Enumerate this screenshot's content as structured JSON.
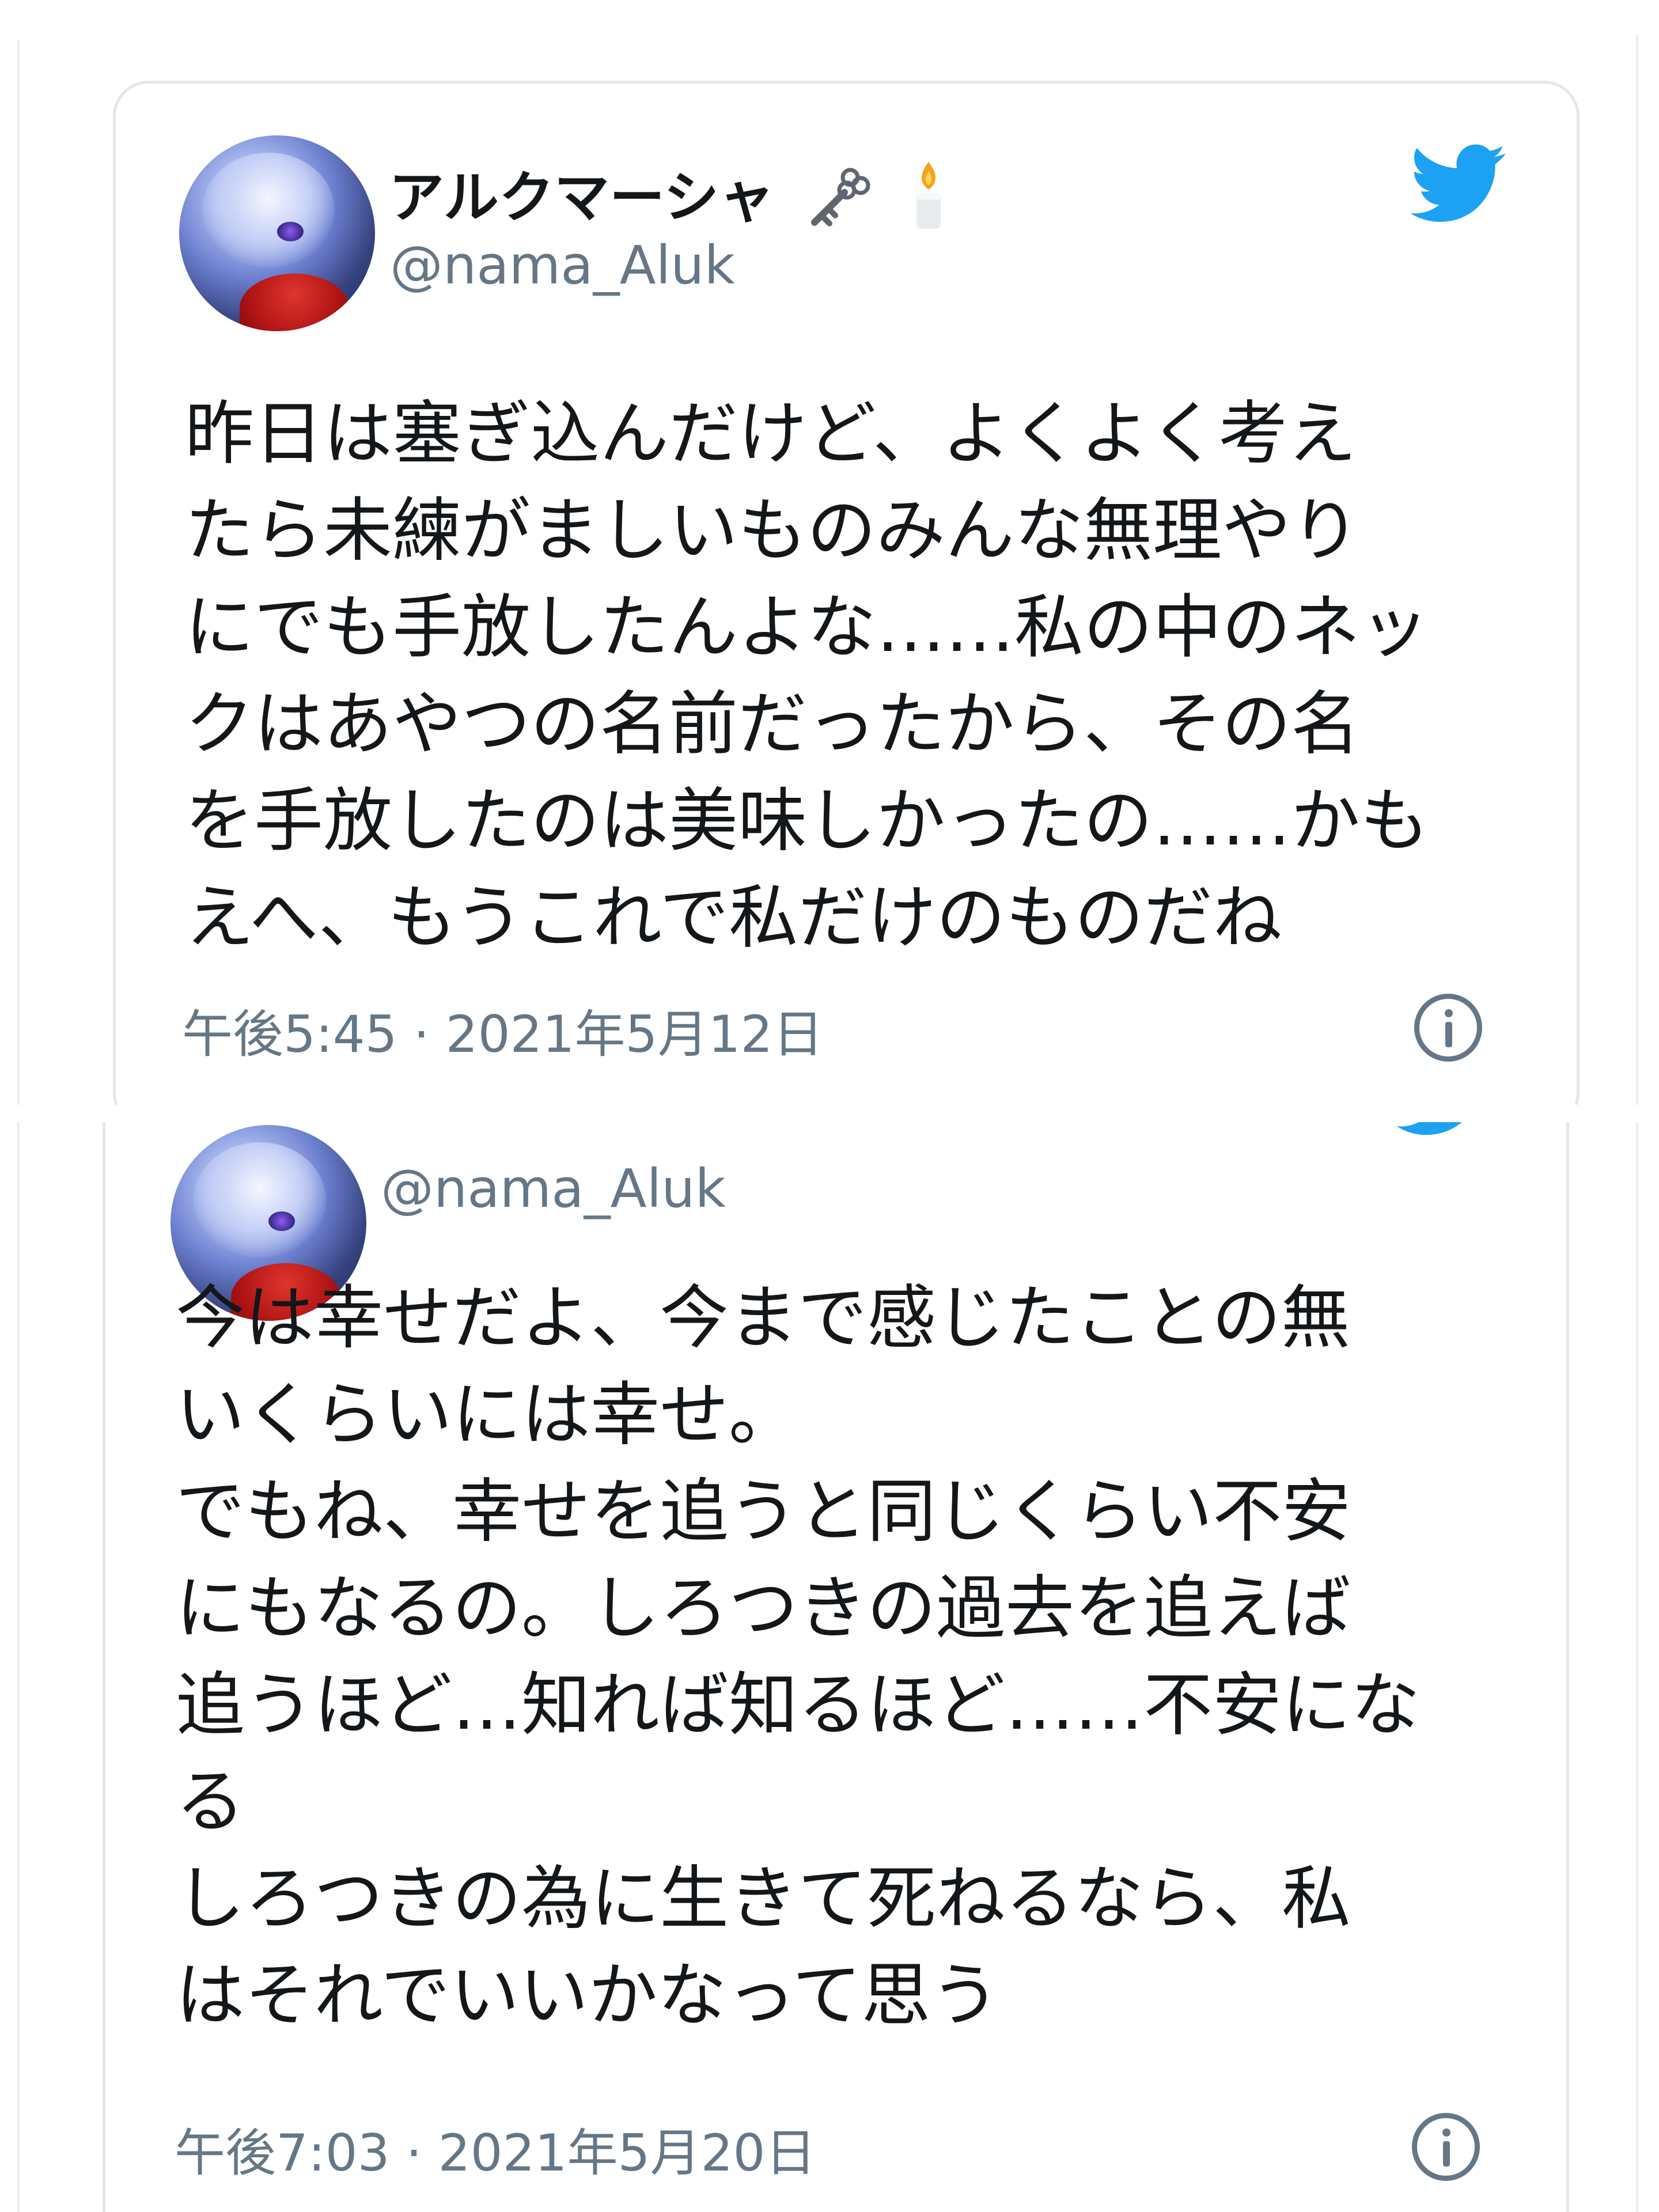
{
  "tweets": [
    {
      "display_name": "アルクマーシャ",
      "name_emojis": [
        "key-icon",
        "candle-icon"
      ],
      "handle": "@nama_Aluk",
      "text_lines": [
        "昨日は塞ぎ込んだけど、よくよく考え",
        "たら未練がましいものみんな無理やり",
        "にでも手放したんよな……私の中のネッ",
        "クはあやつの名前だったから、その名",
        "を手放したのは美味しかったの……かも",
        "えへ、もうこれで私だけのものだね"
      ],
      "time": "午後5:45",
      "separator": "·",
      "date": "2021年5月12日"
    },
    {
      "display_name": "",
      "handle": "@nama_Aluk",
      "text_lines": [
        "今は幸せだよ、今まで感じたことの無",
        "いくらいには幸せ。",
        "でもね、幸せを追うと同じくらい不安",
        "にもなるの。しろつきの過去を追えば",
        "追うほど…知れば知るほど……不安にな",
        "る",
        "しろつきの為に生きて死ねるなら、私",
        "はそれでいいかなって思う"
      ],
      "time": "午後7:03",
      "separator": "·",
      "date": "2021年5月20日"
    }
  ],
  "colors": {
    "twitter_blue": "#1da1f2",
    "text": "#14171a",
    "muted": "#657786",
    "border": "#e1e8ed"
  }
}
